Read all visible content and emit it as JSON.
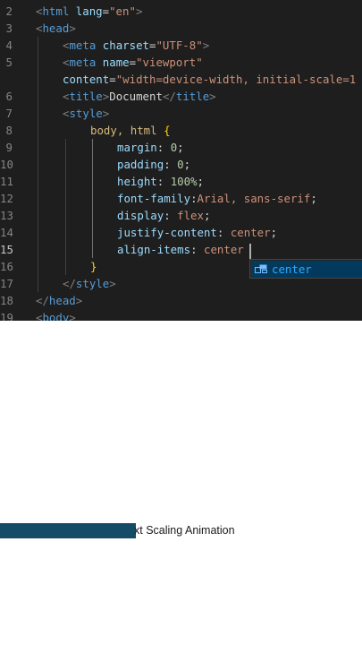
{
  "editor": {
    "lines": [
      {
        "num": "2",
        "tokens": [
          {
            "t": "<",
            "c": "punc"
          },
          {
            "t": "html",
            "c": "tag"
          },
          {
            "t": " ",
            "c": "txt"
          },
          {
            "t": "lang",
            "c": "attr"
          },
          {
            "t": "=",
            "c": "txt"
          },
          {
            "t": "\"en\"",
            "c": "str"
          },
          {
            "t": ">",
            "c": "punc"
          }
        ]
      },
      {
        "num": "3",
        "tokens": [
          {
            "t": "<",
            "c": "punc"
          },
          {
            "t": "head",
            "c": "tag"
          },
          {
            "t": ">",
            "c": "punc"
          }
        ]
      },
      {
        "num": "4",
        "tokens": [
          {
            "t": "<",
            "c": "punc"
          },
          {
            "t": "meta",
            "c": "tag"
          },
          {
            "t": " ",
            "c": "txt"
          },
          {
            "t": "charset",
            "c": "attr"
          },
          {
            "t": "=",
            "c": "txt"
          },
          {
            "t": "\"UTF-8\"",
            "c": "str"
          },
          {
            "t": ">",
            "c": "punc"
          }
        ]
      },
      {
        "num": "5",
        "tokens": [
          {
            "t": "<",
            "c": "punc"
          },
          {
            "t": "meta",
            "c": "tag"
          },
          {
            "t": " ",
            "c": "txt"
          },
          {
            "t": "name",
            "c": "attr"
          },
          {
            "t": "=",
            "c": "txt"
          },
          {
            "t": "\"viewport\"",
            "c": "str"
          }
        ]
      },
      {
        "num": "",
        "tokens": [
          {
            "t": "content",
            "c": "attr"
          },
          {
            "t": "=",
            "c": "txt"
          },
          {
            "t": "\"width=device-width, initial-scale=1",
            "c": "str"
          }
        ]
      },
      {
        "num": "6",
        "tokens": [
          {
            "t": "<",
            "c": "punc"
          },
          {
            "t": "title",
            "c": "tag"
          },
          {
            "t": ">",
            "c": "punc"
          },
          {
            "t": "Document",
            "c": "txt"
          },
          {
            "t": "</",
            "c": "punc"
          },
          {
            "t": "title",
            "c": "tag"
          },
          {
            "t": ">",
            "c": "punc"
          }
        ]
      },
      {
        "num": "7",
        "tokens": [
          {
            "t": "<",
            "c": "punc"
          },
          {
            "t": "style",
            "c": "tag"
          },
          {
            "t": ">",
            "c": "punc"
          }
        ]
      },
      {
        "num": "8",
        "tokens": [
          {
            "t": "body, html ",
            "c": "sel"
          },
          {
            "t": "{",
            "c": "brace"
          }
        ]
      },
      {
        "num": "9",
        "tokens": [
          {
            "t": "margin",
            "c": "prop"
          },
          {
            "t": ": ",
            "c": "txt"
          },
          {
            "t": "0",
            "c": "num"
          },
          {
            "t": ";",
            "c": "txt"
          }
        ]
      },
      {
        "num": "10",
        "tokens": [
          {
            "t": "padding",
            "c": "prop"
          },
          {
            "t": ": ",
            "c": "txt"
          },
          {
            "t": "0",
            "c": "num"
          },
          {
            "t": ";",
            "c": "txt"
          }
        ]
      },
      {
        "num": "11",
        "tokens": [
          {
            "t": "height",
            "c": "prop"
          },
          {
            "t": ": ",
            "c": "txt"
          },
          {
            "t": "100%",
            "c": "num"
          },
          {
            "t": ";",
            "c": "txt"
          }
        ]
      },
      {
        "num": "12",
        "tokens": [
          {
            "t": "font-family",
            "c": "prop"
          },
          {
            "t": ":",
            "c": "txt"
          },
          {
            "t": "Arial, sans-serif",
            "c": "val"
          },
          {
            "t": ";",
            "c": "txt"
          }
        ]
      },
      {
        "num": "13",
        "tokens": [
          {
            "t": "display",
            "c": "prop"
          },
          {
            "t": ": ",
            "c": "txt"
          },
          {
            "t": "flex",
            "c": "val"
          },
          {
            "t": ";",
            "c": "txt"
          }
        ]
      },
      {
        "num": "14",
        "tokens": [
          {
            "t": "justify-content",
            "c": "prop"
          },
          {
            "t": ": ",
            "c": "txt"
          },
          {
            "t": "center",
            "c": "val"
          },
          {
            "t": ";",
            "c": "txt"
          }
        ]
      },
      {
        "num": "15",
        "tokens": [
          {
            "t": "align-items",
            "c": "prop"
          },
          {
            "t": ": ",
            "c": "txt"
          },
          {
            "t": "center",
            "c": "val"
          }
        ]
      },
      {
        "num": "16",
        "tokens": [
          {
            "t": "}",
            "c": "brace"
          }
        ]
      },
      {
        "num": "17",
        "tokens": [
          {
            "t": "</",
            "c": "punc"
          },
          {
            "t": "style",
            "c": "tag"
          },
          {
            "t": ">",
            "c": "punc"
          }
        ]
      },
      {
        "num": "18",
        "tokens": [
          {
            "t": "</",
            "c": "punc"
          },
          {
            "t": "head",
            "c": "tag"
          },
          {
            "t": ">",
            "c": "punc"
          }
        ]
      },
      {
        "num": "19",
        "tokens": [
          {
            "t": "<",
            "c": "punc"
          },
          {
            "t": "body",
            "c": "tag"
          },
          {
            "t": ">",
            "c": "punc"
          }
        ]
      }
    ],
    "active_line": "15",
    "suggestion": {
      "icon": "property-snippet-icon",
      "label": "center"
    }
  },
  "colors": {
    "editor_bg": "#1e1e1e",
    "tag": "#569cd6",
    "attribute": "#9cdcfe",
    "string": "#ce9178",
    "selector": "#d7ba7d",
    "number": "#b5cea8",
    "suggestion_highlight": "#04395e",
    "caption_bar": "#154b66"
  },
  "preview": {
    "caption": "xt Scaling Animation"
  }
}
